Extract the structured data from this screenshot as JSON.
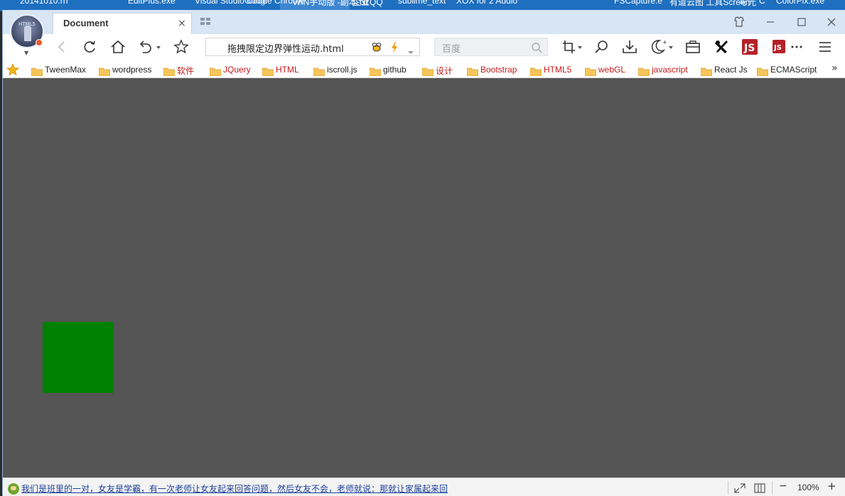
{
  "taskbar": {
    "items": [
      "20141010.rrr",
      "EditPlus.exe",
      "Visual Studio Code",
      "Google Chrome",
      "WIN手动版 -副本.txt",
      "企业QQ",
      "sublime_text",
      "XOX for 2 Audio",
      "FSCapture.e",
      "有道云图 工具Screen",
      "与光",
      "C",
      "ColorPix.exe"
    ]
  },
  "browser": {
    "tab_title": "Document",
    "tab_close": "×",
    "address": "拖拽限定边界弹性运动.html",
    "search_placeholder": "百度",
    "avatar_text": "HTML5"
  },
  "bookmarks": [
    {
      "label": "TweenMax",
      "color": "normal"
    },
    {
      "label": "wordpress",
      "color": "normal"
    },
    {
      "label": "软件",
      "color": "red"
    },
    {
      "label": "JQuery",
      "color": "red"
    },
    {
      "label": "HTML",
      "color": "red"
    },
    {
      "label": "iscroll.js",
      "color": "normal"
    },
    {
      "label": "github",
      "color": "normal"
    },
    {
      "label": "设计",
      "color": "red"
    },
    {
      "label": "Bootstrap",
      "color": "red"
    },
    {
      "label": "HTML5",
      "color": "red"
    },
    {
      "label": "webGL",
      "color": "red"
    },
    {
      "label": "javascript",
      "color": "red"
    },
    {
      "label": "React Js",
      "color": "normal"
    },
    {
      "label": "ECMAScript",
      "color": "normal"
    }
  ],
  "bookmarks_more": "»",
  "content": {
    "background": "#555555",
    "box_color": "#008000"
  },
  "statusbar": {
    "news": "我们是班里的一对，女友是学霸，有一次老师让女友起来回答问题，然后女友不会，老师就说：那就让家属起来回",
    "zoom": "100%",
    "zoom_minus": "−",
    "zoom_plus": "+"
  },
  "icons": {
    "back": "back-arrow-icon",
    "refresh": "refresh-icon",
    "home": "home-icon",
    "undo": "undo-icon",
    "favorite": "star-icon",
    "crop": "crop-icon",
    "find": "search-icon",
    "download": "download-icon",
    "night": "moon-icon",
    "toolbox": "toolbox-icon",
    "tools": "tools-icon",
    "js1": "js-icon",
    "js2": "js-badge-icon",
    "more": "more-icon",
    "menu": "menu-icon"
  }
}
